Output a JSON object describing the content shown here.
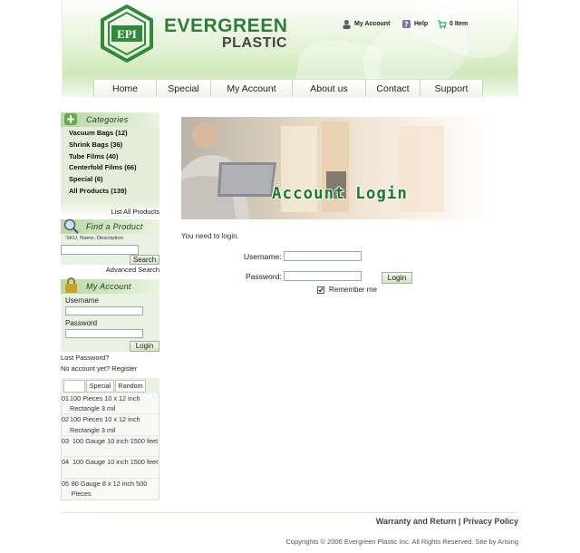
{
  "brand": {
    "logo_text": "EPI",
    "name_line1": "EVERGREEN",
    "name_line2": "PLASTIC"
  },
  "top_links": [
    {
      "label": "My Account",
      "icon": "user-icon"
    },
    {
      "label": "Help",
      "icon": "help-icon"
    },
    {
      "label": "0 Item",
      "icon": "cart-icon"
    }
  ],
  "nav": [
    "Home",
    "Special",
    "My Account",
    "About us",
    "Contact",
    "Support"
  ],
  "sidebar": {
    "categories": {
      "title": "Categories",
      "items": [
        "Vacuum Bags (12)",
        "Shrink Bags (36)",
        "Tube Films (40)",
        "Centerfold Films (66)",
        "Special (6)",
        "All Products (139)"
      ],
      "list_all": "List All Products"
    },
    "find": {
      "title": "Find a Product",
      "hint": "SKU, Name, Description",
      "search_button": "Search",
      "advanced": "Advanced Search"
    },
    "account": {
      "title": "My Account",
      "username_label": "Username",
      "password_label": "Password",
      "login_button": "Login",
      "lost_password": "Lost Password?",
      "no_account": "No account yet? Register"
    },
    "tabs": [
      "",
      "Special",
      "Random"
    ],
    "products": [
      {
        "num": "01",
        "text": "100 Pieces 10 x 12 inch Rectangle 3 mil"
      },
      {
        "num": "02",
        "text": "100 Pieces 10 x 12 inch Rectangle 3 mil"
      },
      {
        "num": "03",
        "text": "100 Gauge 10 inch 1500 feet"
      },
      {
        "num": "04",
        "text": "100 Gauge 10 inch 1500 feet"
      },
      {
        "num": "05",
        "text": "80 Gauge 8 x 12 inch 500 Pieces"
      }
    ]
  },
  "main": {
    "banner_title": "Account Login",
    "message": "You need to login.",
    "username_label": "Username:",
    "password_label": "Password:",
    "login_button": "Login",
    "remember_label": "Remember me"
  },
  "footer": {
    "warranty": "Warranty and Return",
    "separator": "|",
    "privacy": "Privacy Policy",
    "copyright": "Copyrights © 2006 Evergreen Plastic Inc. All Rights Reserved. Site by Arising"
  },
  "colors": {
    "brand_green": "#2f7d3a",
    "banner_green": "#1c7a2c",
    "sidebar_bg": "#e3edd8"
  }
}
